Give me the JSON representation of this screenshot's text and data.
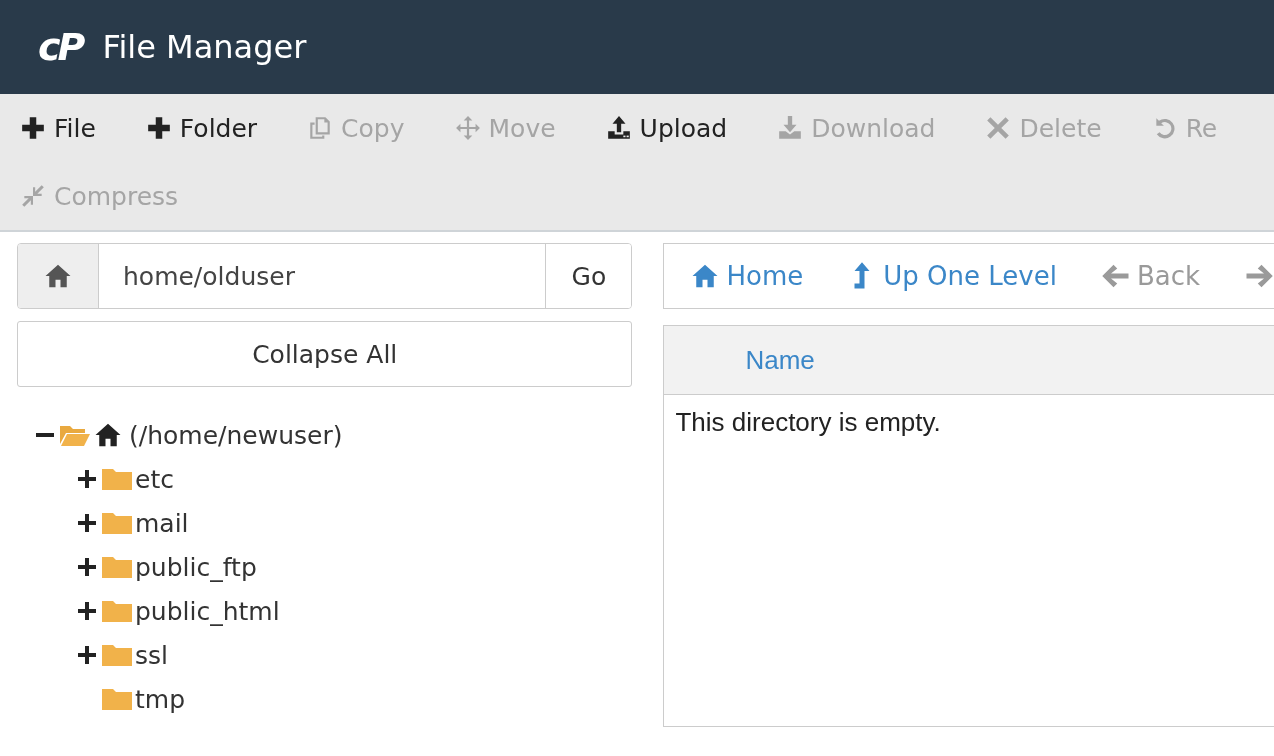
{
  "header": {
    "logo": "cP",
    "title": "File Manager"
  },
  "toolbar": {
    "rows": [
      [
        {
          "kind": "plus",
          "label": "File",
          "disabled": false
        },
        {
          "kind": "plus",
          "label": "Folder",
          "disabled": false
        },
        {
          "kind": "copy",
          "label": "Copy",
          "disabled": true
        },
        {
          "kind": "move",
          "label": "Move",
          "disabled": true
        },
        {
          "kind": "upload",
          "label": "Upload",
          "disabled": false
        },
        {
          "kind": "download",
          "label": "Download",
          "disabled": true
        },
        {
          "kind": "delete",
          "label": "Delete",
          "disabled": true
        },
        {
          "kind": "undo",
          "label": "Re",
          "disabled": true
        }
      ],
      [
        {
          "kind": "compress",
          "label": "Compress",
          "disabled": true
        }
      ]
    ]
  },
  "path_bar": {
    "value": "home/olduser",
    "button": "Go"
  },
  "collapse_button": "Collapse All",
  "tree": [
    {
      "kind": "home",
      "label": "(/home/newuser)",
      "expanded": true,
      "children": [
        {
          "kind": "folder",
          "label": "etc",
          "expanded": false
        },
        {
          "kind": "folder",
          "label": "mail",
          "expanded": false
        },
        {
          "kind": "folder",
          "label": "public_ftp",
          "expanded": false
        },
        {
          "kind": "folder",
          "label": "public_html",
          "expanded": false
        },
        {
          "kind": "folder",
          "label": "ssl",
          "expanded": false
        },
        {
          "kind": "leaf",
          "label": "tmp"
        }
      ]
    }
  ],
  "nav": [
    {
      "kind": "home",
      "label": "Home",
      "disabled": false
    },
    {
      "kind": "up",
      "label": "Up One Level",
      "disabled": false
    },
    {
      "kind": "back",
      "label": "Back",
      "disabled": true
    },
    {
      "kind": "forward",
      "disabled": true
    }
  ],
  "table": {
    "columns": [
      "Name"
    ],
    "empty_message": "This directory is empty."
  }
}
